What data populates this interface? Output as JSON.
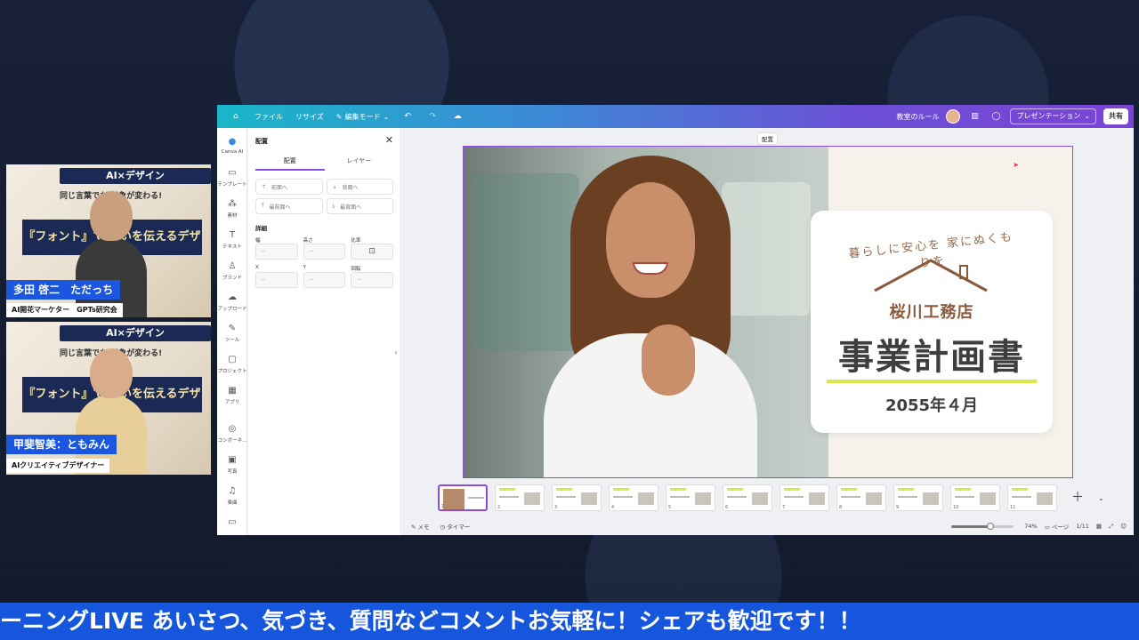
{
  "webcams": [
    {
      "banner_top": "AI×デザイン",
      "banner_sub": "同じ言葉でも 印象が変わる!",
      "banner_big": "『フォント』で 想いを伝えるデザイン術",
      "name": "多田 啓二　ただっち",
      "role": "AI開花マーケター　GPTs研究会"
    },
    {
      "banner_top": "AI×デザイン",
      "banner_sub": "同じ言葉でも 印象が変わる!",
      "banner_big": "『フォント』で 想いを伝えるデザイン術",
      "name": "甲斐智美：ともみん",
      "role": "AIクリエイティブデザイナー"
    }
  ],
  "topbar": {
    "file": "ファイル",
    "resize": "リサイズ",
    "edit_mode": "編集モード",
    "doc_name": "教室のルール",
    "present": "プレゼンテーション",
    "share": "共有"
  },
  "leftnav": [
    "Canva AI",
    "テンプレート",
    "素材",
    "テキスト",
    "ブランド",
    "アップロード",
    "ツール",
    "プロジェクト",
    "アプリ",
    "コンポーネ...",
    "写真",
    "楽曲"
  ],
  "panel": {
    "title": "配置",
    "tabs": [
      "配置",
      "レイヤー"
    ],
    "buttons": [
      "前面へ",
      "背面へ",
      "最前面へ",
      "最背面へ"
    ],
    "section": "詳細",
    "fields": [
      {
        "label": "幅",
        "value": "--"
      },
      {
        "label": "高さ",
        "value": "--"
      },
      {
        "label": "比率",
        "value": ""
      },
      {
        "label": "X",
        "value": "--"
      },
      {
        "label": "Y",
        "value": "--"
      },
      {
        "label": "回転",
        "value": "--"
      }
    ]
  },
  "canvas": {
    "label": "配置",
    "slide": {
      "tagline": "暮らしに安心を 家にぬくもりを",
      "company": "桜川工務店",
      "title": "事業計画書",
      "date": "2055年４月"
    }
  },
  "thumbnails": [
    "1",
    "2",
    "3",
    "4",
    "5",
    "6",
    "7",
    "8",
    "9",
    "10",
    "11"
  ],
  "bottombar": {
    "memo": "メモ",
    "timer": "タイマー",
    "zoom": "74%",
    "zoom_level": 0.74,
    "page_btn": "ページ",
    "page": "1/11"
  },
  "ticker": "ーニングLIVE あいさつ、気づき、質問などコメントお気軽に！シェアも歓迎です！！",
  "colors": {
    "accent": "#8a4fe0",
    "ticker": "#1556dc",
    "lime": "#d7ea4a"
  }
}
